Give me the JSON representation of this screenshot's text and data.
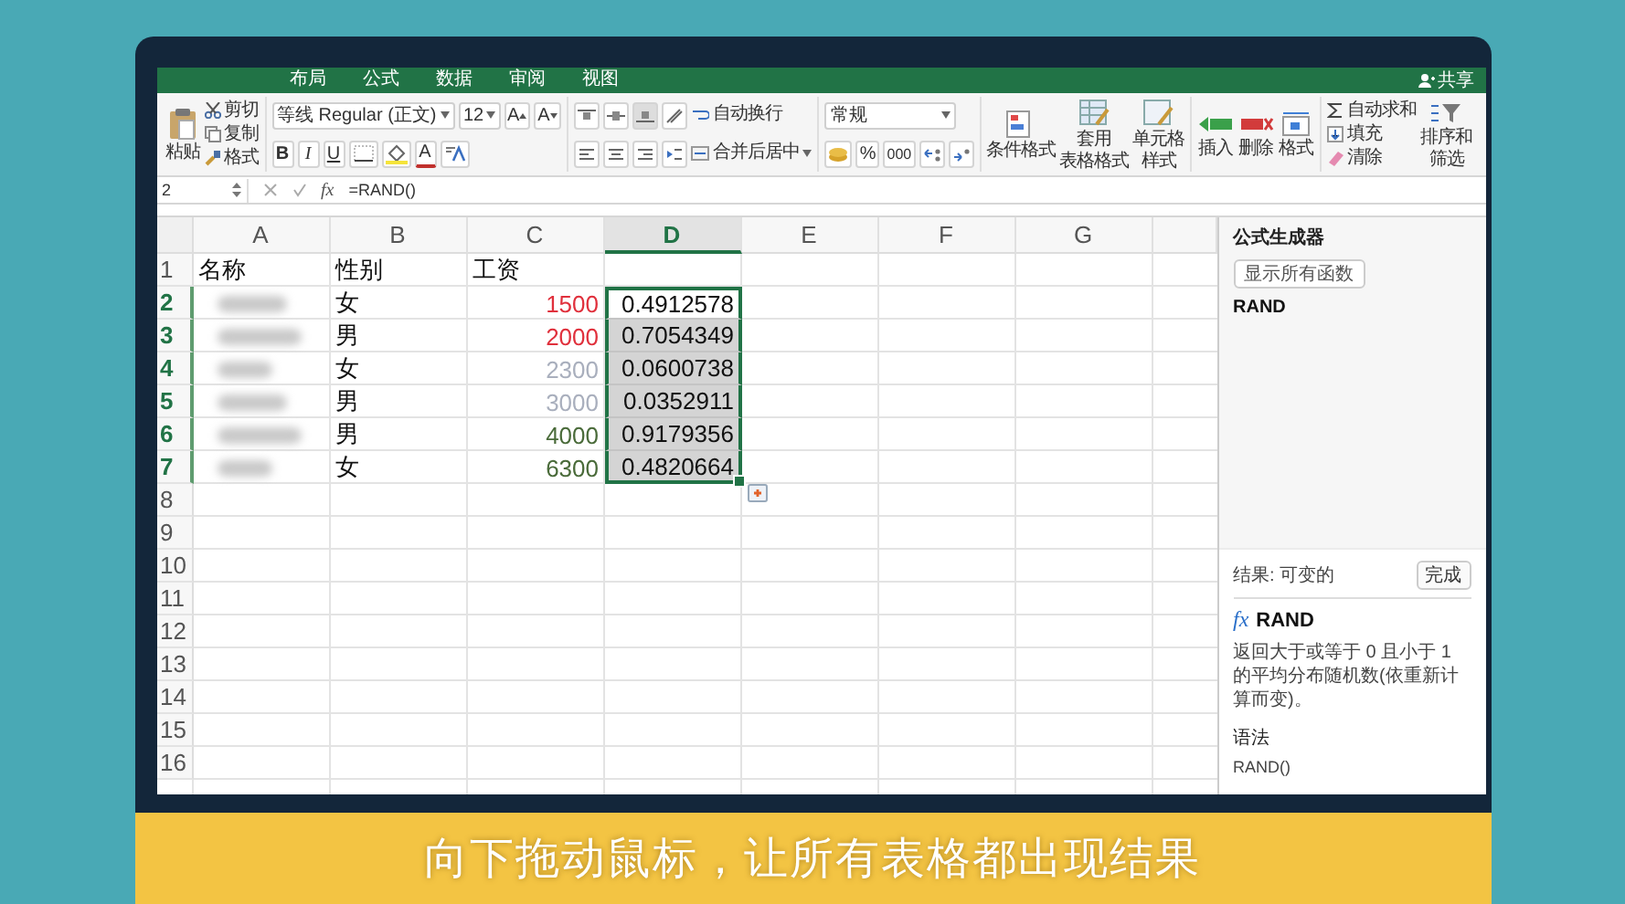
{
  "ribbon_tabs": [
    {
      "label": "布局",
      "selected": false
    },
    {
      "label": "公式",
      "selected": false
    },
    {
      "label": "数据",
      "selected": false
    },
    {
      "label": "审阅",
      "selected": false
    },
    {
      "label": "视图",
      "selected": false
    }
  ],
  "share_button": "共享",
  "clipboard": {
    "paste": "粘贴",
    "cut": "剪切",
    "copy": "复制",
    "format_painter": "格式"
  },
  "font": {
    "name": "等线 Regular (正文)",
    "size": "12",
    "grow": "A",
    "shrink": "A",
    "bold": "B",
    "italic": "I",
    "underline": "U",
    "font_color": "A"
  },
  "alignment": {
    "wrap_text": "自动换行",
    "merge_center": "合并后居中"
  },
  "number": {
    "format": "常规",
    "percent": "%",
    "thousands": "000"
  },
  "styles": [
    {
      "lines": [
        "条件格式"
      ]
    },
    {
      "lines": [
        "套用",
        "表格格式"
      ]
    },
    {
      "lines": [
        "单元格",
        "样式"
      ]
    }
  ],
  "cells": [
    "插入",
    "删除",
    "格式"
  ],
  "editing": {
    "autosum": "自动求和",
    "fill": "填充",
    "clear": "清除",
    "sort_filter": [
      "排序和",
      "筛选"
    ]
  },
  "formula_bar": {
    "name_box": "2",
    "fx": "fx",
    "formula": "=RAND()"
  },
  "sheet": {
    "columns": [
      {
        "label": "A",
        "selected": false
      },
      {
        "label": "B",
        "selected": false
      },
      {
        "label": "C",
        "selected": false
      },
      {
        "label": "D",
        "selected": true
      },
      {
        "label": "E",
        "selected": false
      },
      {
        "label": "F",
        "selected": false
      },
      {
        "label": "G",
        "selected": false
      }
    ],
    "rows": [
      {
        "number": "1",
        "selected": false,
        "name": "名称",
        "gender": "性别",
        "salary": "工资"
      },
      {
        "number": "2",
        "selected": true,
        "active": true,
        "redacted": true,
        "gender": "女",
        "salary": "1500",
        "color": "#e0303c",
        "value": "0.4912578"
      },
      {
        "number": "3",
        "selected": true,
        "active": false,
        "redacted": true,
        "gender": "男",
        "salary": "2000",
        "color": "#e0303c",
        "value": "0.7054349"
      },
      {
        "number": "4",
        "selected": true,
        "active": false,
        "redacted": true,
        "gender": "女",
        "salary": "2300",
        "color": "#a9afbd",
        "value": "0.0600738"
      },
      {
        "number": "5",
        "selected": true,
        "active": false,
        "redacted": true,
        "gender": "男",
        "salary": "3000",
        "color": "#a9afbd",
        "value": "0.0352911"
      },
      {
        "number": "6",
        "selected": true,
        "active": false,
        "redacted": true,
        "gender": "男",
        "salary": "4000",
        "color": "#4a6b3a",
        "value": "0.9179356"
      },
      {
        "number": "7",
        "selected": true,
        "active": false,
        "redacted": true,
        "gender": "女",
        "salary": "6300",
        "color": "#4a6b3a",
        "value": "0.4820664"
      },
      {
        "number": "8",
        "selected": false
      },
      {
        "number": "9",
        "selected": false
      },
      {
        "number": "10",
        "selected": false
      },
      {
        "number": "11",
        "selected": false
      },
      {
        "number": "12",
        "selected": false
      },
      {
        "number": "13",
        "selected": false
      },
      {
        "number": "14",
        "selected": false
      },
      {
        "number": "15",
        "selected": false
      },
      {
        "number": "16",
        "selected": false
      }
    ]
  },
  "formula_builder": {
    "title": "公式生成器",
    "show_all_button": "显示所有函数",
    "function_name": "RAND",
    "result_label": "结果: 可变的",
    "done_button": "完成",
    "fx": "fx",
    "help_title": "RAND",
    "description": "返回大于或等于 0 且小于 1 的平均分布随机数(依重新计算而变)。",
    "syntax_heading": "语法",
    "syntax": "RAND()"
  },
  "subtitle": "向下拖动鼠标，让所有表格都出现结果"
}
